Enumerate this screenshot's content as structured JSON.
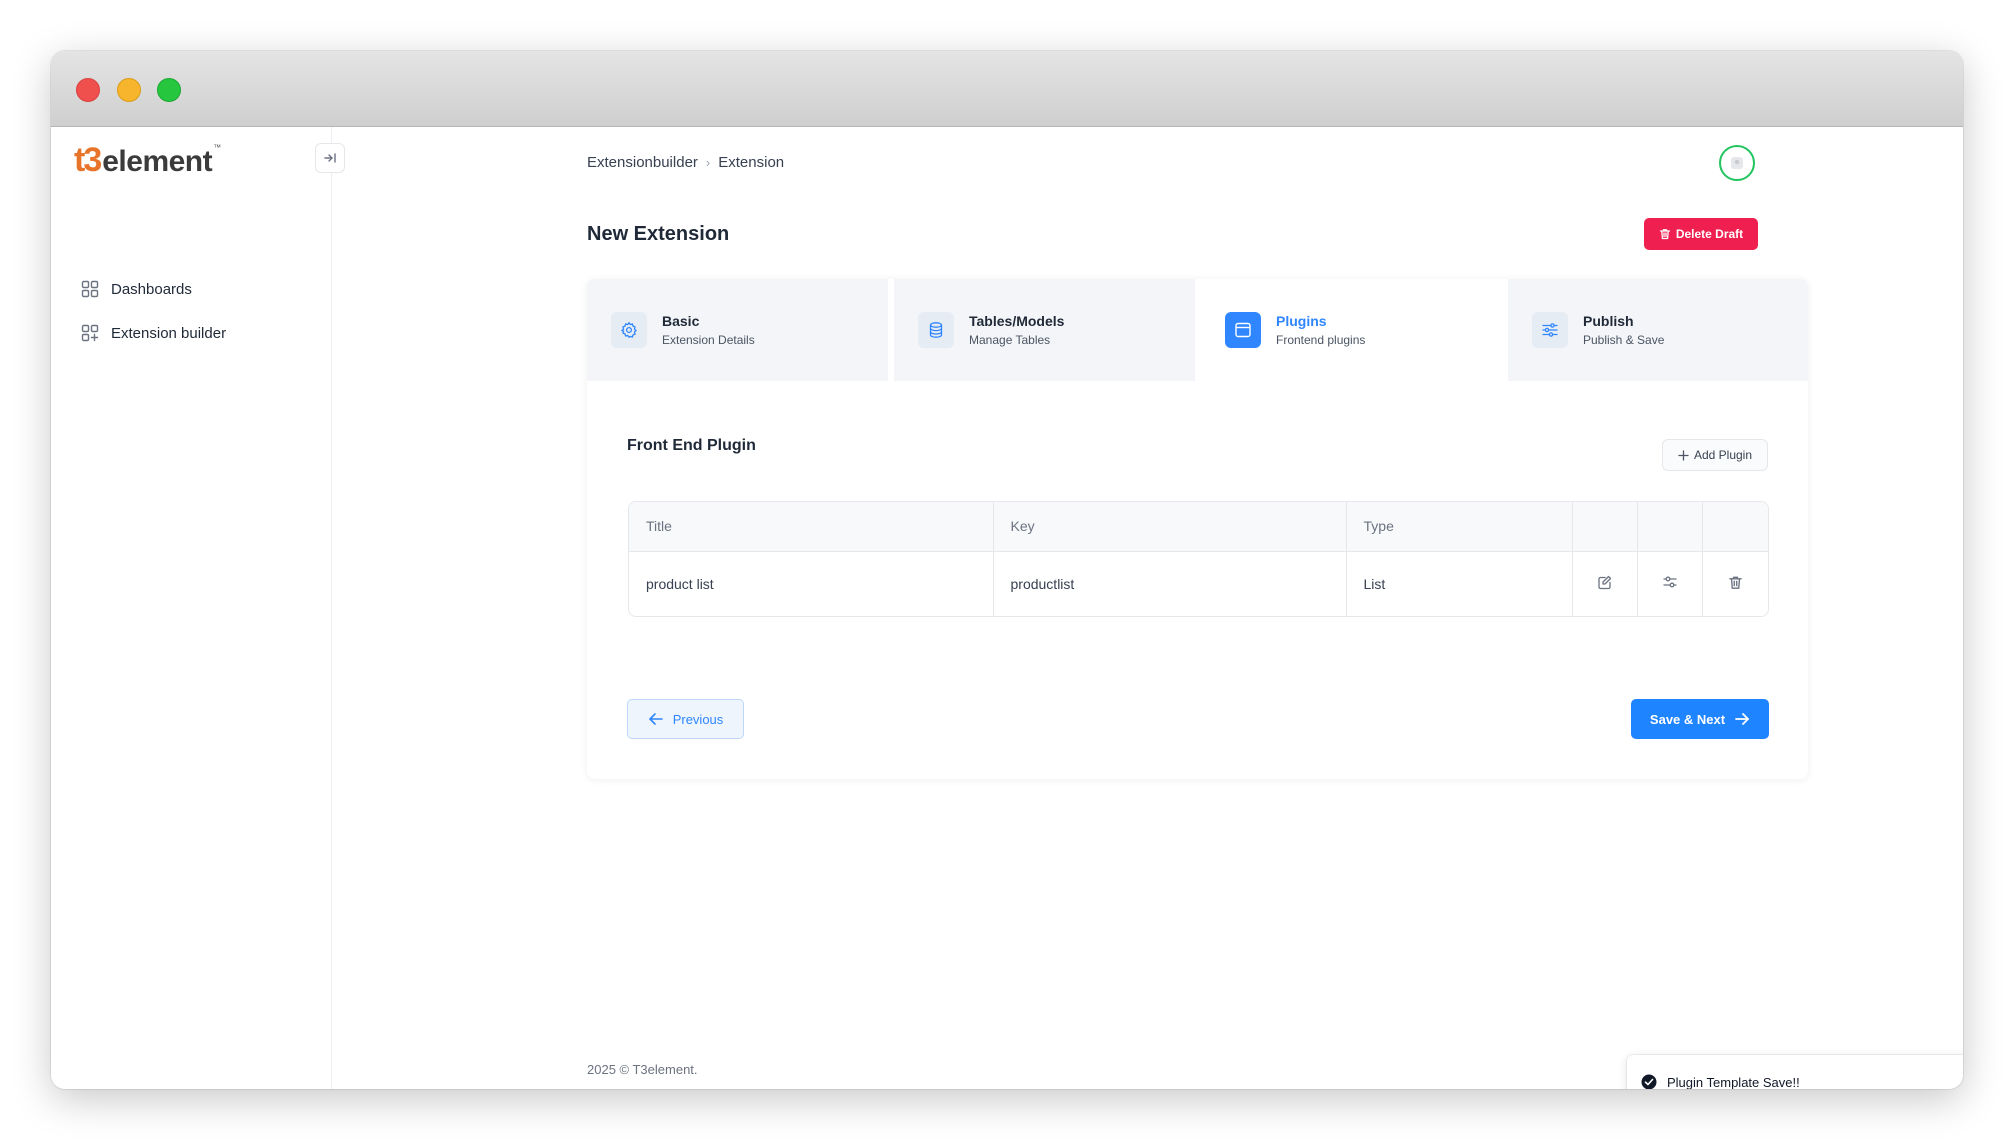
{
  "brand": {
    "mark": "t3",
    "name": "element",
    "tm": "™"
  },
  "sidebar": {
    "collapse_icon": "collapse-right-icon",
    "items": [
      {
        "label": "Dashboards",
        "icon": "grid-icon"
      },
      {
        "label": "Extension builder",
        "icon": "grid-plus-icon"
      }
    ]
  },
  "breadcrumb": {
    "items": [
      "Extensionbuilder",
      "Extension"
    ]
  },
  "page": {
    "title": "New Extension",
    "delete_label": "Delete Draft"
  },
  "tabs": [
    {
      "title": "Basic",
      "subtitle": "Extension Details",
      "icon": "gear-icon",
      "active": false
    },
    {
      "title": "Tables/Models",
      "subtitle": "Manage Tables",
      "icon": "database-icon",
      "active": false
    },
    {
      "title": "Plugins",
      "subtitle": "Frontend plugins",
      "icon": "window-icon",
      "active": true
    },
    {
      "title": "Publish",
      "subtitle": "Publish & Save",
      "icon": "sliders-icon",
      "active": false
    }
  ],
  "section": {
    "title": "Front End Plugin",
    "add_label": "Add Plugin"
  },
  "table": {
    "headers": [
      "Title",
      "Key",
      "Type"
    ],
    "rows": [
      {
        "title": "product list",
        "key": "productlist",
        "type": "List"
      }
    ]
  },
  "nav_buttons": {
    "previous": "Previous",
    "next": "Save & Next"
  },
  "footer": {
    "text": "2025 ©  T3element."
  },
  "toast": {
    "message": "Plugin Template Save!!"
  },
  "colors": {
    "accent": "#1f84ff",
    "danger": "#ef1f4f",
    "avatar_ring": "#22c55e",
    "tab_inactive_bg": "#f3f5f8"
  }
}
